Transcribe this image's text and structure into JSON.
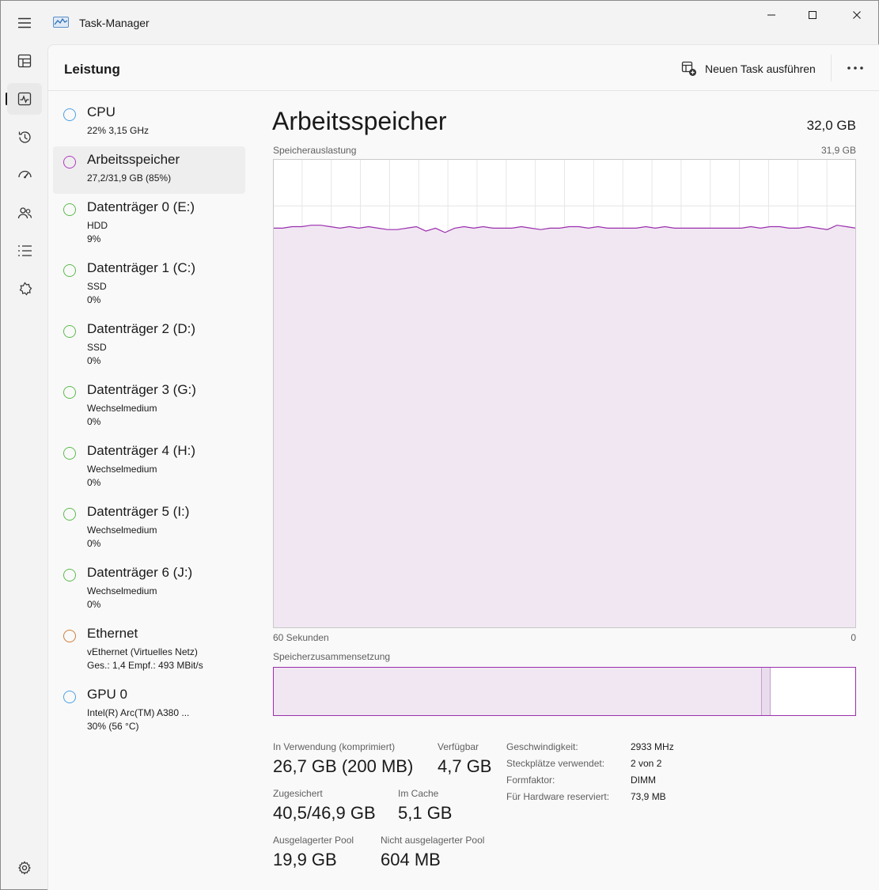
{
  "window": {
    "title": "Task-Manager"
  },
  "header": {
    "page_title": "Leistung",
    "run_task_label": "Neuen Task ausführen"
  },
  "devices": [
    {
      "name": "CPU",
      "line1": "22%  3,15 GHz",
      "line2": "",
      "circle_color": "#4aa0e6",
      "selected": false
    },
    {
      "name": "Arbeitsspeicher",
      "line1": "27,2/31,9 GB (85%)",
      "line2": "",
      "circle_color": "#b03bc2",
      "selected": true
    },
    {
      "name": "Datenträger 0 (E:)",
      "line1": "HDD",
      "line2": "9%",
      "circle_color": "#5cbb4c",
      "selected": false
    },
    {
      "name": "Datenträger 1 (C:)",
      "line1": "SSD",
      "line2": "0%",
      "circle_color": "#5cbb4c",
      "selected": false
    },
    {
      "name": "Datenträger 2 (D:)",
      "line1": "SSD",
      "line2": "0%",
      "circle_color": "#5cbb4c",
      "selected": false
    },
    {
      "name": "Datenträger 3 (G:)",
      "line1": "Wechselmedium",
      "line2": "0%",
      "circle_color": "#5cbb4c",
      "selected": false
    },
    {
      "name": "Datenträger 4 (H:)",
      "line1": "Wechselmedium",
      "line2": "0%",
      "circle_color": "#5cbb4c",
      "selected": false
    },
    {
      "name": "Datenträger 5 (I:)",
      "line1": "Wechselmedium",
      "line2": "0%",
      "circle_color": "#5cbb4c",
      "selected": false
    },
    {
      "name": "Datenträger 6 (J:)",
      "line1": "Wechselmedium",
      "line2": "0%",
      "circle_color": "#5cbb4c",
      "selected": false
    },
    {
      "name": "Ethernet",
      "line1": "vEthernet (Virtuelles Netz)",
      "line2": "Ges.: 1,4 Empf.: 493 MBit/s",
      "circle_color": "#d27d3a",
      "selected": false
    },
    {
      "name": "GPU 0",
      "line1": "Intel(R) Arc(TM) A380 ...",
      "line2": "30%  (56 °C)",
      "circle_color": "#4aa0e6",
      "selected": false
    }
  ],
  "detail": {
    "title": "Arbeitsspeicher",
    "total": "32,0 GB",
    "usage_label": "Speicherauslastung",
    "usage_max": "31,9 GB",
    "time_left": "60 Sekunden",
    "time_right": "0",
    "composition_label": "Speicherzusammensetzung"
  },
  "chart_data": {
    "type": "area",
    "title": "Speicherauslastung",
    "xlabel": "",
    "ylabel": "",
    "x_range_label": [
      "60 Sekunden",
      "0"
    ],
    "ylim": [
      0,
      31.9
    ],
    "unit": "GB",
    "grid": true,
    "line_color": "#9b2fae",
    "fill_color": "#f1e7f2",
    "values": [
      27.2,
      27.2,
      27.3,
      27.3,
      27.4,
      27.4,
      27.3,
      27.2,
      27.3,
      27.2,
      27.3,
      27.2,
      27.1,
      27.1,
      27.2,
      27.3,
      27.0,
      27.2,
      26.9,
      27.2,
      27.3,
      27.2,
      27.3,
      27.2,
      27.2,
      27.2,
      27.3,
      27.2,
      27.1,
      27.2,
      27.2,
      27.3,
      27.3,
      27.2,
      27.3,
      27.2,
      27.2,
      27.2,
      27.2,
      27.3,
      27.2,
      27.3,
      27.2,
      27.2,
      27.2,
      27.2,
      27.2,
      27.2,
      27.2,
      27.2,
      27.3,
      27.2,
      27.3,
      27.3,
      27.2,
      27.2,
      27.3,
      27.2,
      27.1,
      27.4,
      27.3,
      27.2
    ]
  },
  "composition": {
    "in_use_fraction": 0.839,
    "modified_fraction": 0.015,
    "standby_fraction": 0.0,
    "free_fraction": 0.146
  },
  "stats": {
    "in_use_label": "In Verwendung (komprimiert)",
    "in_use_value": "26,7 GB (200 MB)",
    "available_label": "Verfügbar",
    "available_value": "4,7 GB",
    "committed_label": "Zugesichert",
    "committed_value": "40,5/46,9 GB",
    "cached_label": "Im Cache",
    "cached_value": "5,1 GB",
    "paged_label": "Ausgelagerter Pool",
    "paged_value": "19,9 GB",
    "nonpaged_label": "Nicht ausgelagerter Pool",
    "nonpaged_value": "604 MB"
  },
  "info": [
    {
      "label": "Geschwindigkeit:",
      "value": "2933 MHz"
    },
    {
      "label": "Steckplätze verwendet:",
      "value": "2 von 2"
    },
    {
      "label": "Formfaktor:",
      "value": "DIMM"
    },
    {
      "label": "Für Hardware reserviert:",
      "value": "73,9 MB"
    }
  ],
  "icons": {
    "menu": "hamburger-icon",
    "processes": "processes-icon",
    "performance": "performance-icon",
    "history": "app-history-icon",
    "startup": "startup-apps-icon",
    "users": "users-icon",
    "details": "details-icon",
    "services": "services-icon",
    "settings": "gear-icon"
  }
}
